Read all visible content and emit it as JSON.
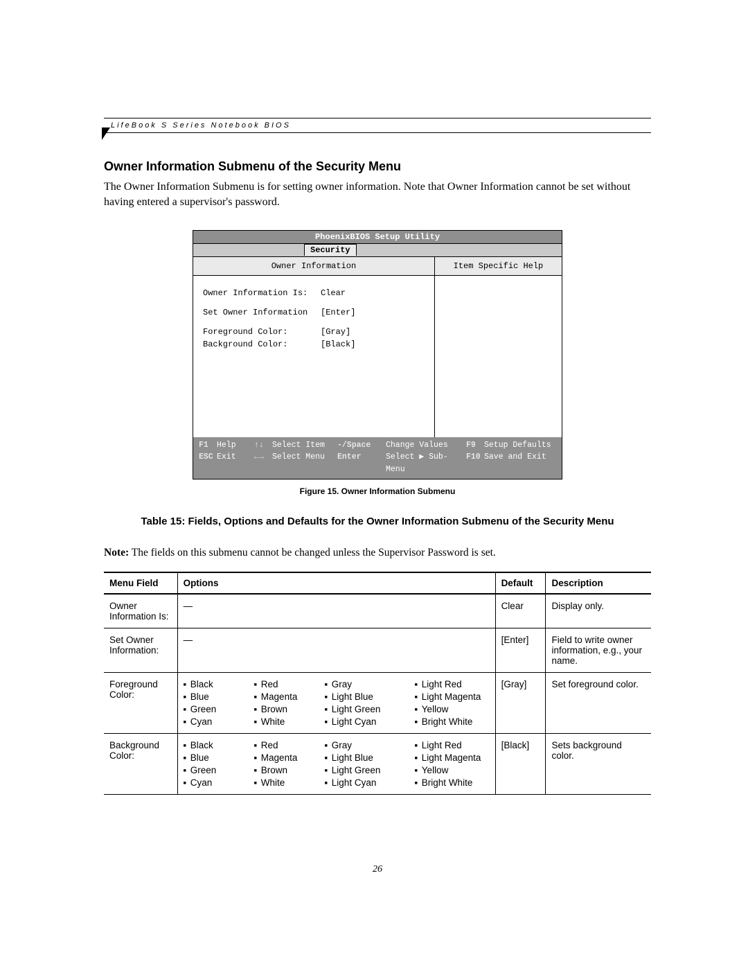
{
  "running_head": "LifeBook S Series Notebook BIOS",
  "section_title": "Owner Information Submenu of the Security Menu",
  "intro": "The Owner Information Submenu is for setting owner information. Note that Owner Information cannot be set without having entered a supervisor's password.",
  "bios": {
    "utility_title": "PhoenixBIOS Setup Utility",
    "tab": "Security",
    "panel_title": "Owner Information",
    "help_title": "Item Specific Help",
    "rows": [
      {
        "label": "Owner Information Is:",
        "value": "Clear"
      },
      {
        "label": "Set Owner Information",
        "value": "[Enter]"
      },
      {
        "label": "Foreground Color:",
        "value": "[Gray]"
      },
      {
        "label": "Background Color:",
        "value": "[Black]"
      }
    ],
    "footer": {
      "f1": "F1",
      "help": "Help",
      "updown": "↑↓",
      "sel_item": "Select Item",
      "minus": "-/Space",
      "chg": "Change Values",
      "f9": "F9",
      "setup_def": "Setup Defaults",
      "esc": "ESC",
      "exit": "Exit",
      "leftright": "←→",
      "sel_menu": "Select Menu",
      "enter": "Enter",
      "sel_sub": "Select ▶ Sub-Menu",
      "f10": "F10",
      "save_exit": "Save and Exit"
    }
  },
  "figure_caption": "Figure 15.  Owner Information Submenu",
  "table_caption": "Table 15: Fields, Options and Defaults for the Owner Information Submenu of the Security Menu",
  "note_label": "Note:",
  "note_text": " The fields on this submenu cannot be changed unless the Supervisor Password is set.",
  "th": {
    "menu": "Menu Field",
    "opts": "Options",
    "def": "Default",
    "desc": "Description"
  },
  "rows": [
    {
      "menu": "Owner Information Is:",
      "opts_text": "—",
      "def": "Clear",
      "desc": "Display only."
    },
    {
      "menu": "Set Owner Information:",
      "opts_text": "—",
      "def": "[Enter]",
      "desc": "Field to write owner information, e.g., your name."
    },
    {
      "menu": "Foreground Color:",
      "def": "[Gray]",
      "desc": "Set foreground color."
    },
    {
      "menu": "Background Color:",
      "def": "[Black]",
      "desc": "Sets background color."
    }
  ],
  "color_cols": [
    [
      "Black",
      "Blue",
      "Green",
      "Cyan"
    ],
    [
      "Red",
      "Magenta",
      "Brown",
      "White"
    ],
    [
      "Gray",
      "Light Blue",
      "Light Green",
      "Light Cyan"
    ],
    [
      "Light Red",
      "Light Magenta",
      "Yellow",
      "Bright White"
    ]
  ],
  "page_number": "26"
}
